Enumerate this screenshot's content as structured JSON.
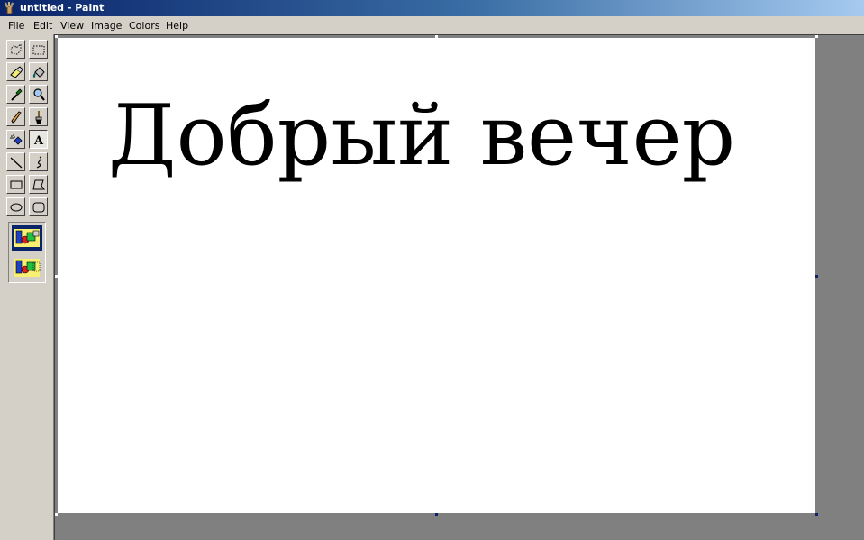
{
  "window": {
    "title": "untitled - Paint"
  },
  "menu": {
    "items": [
      "File",
      "Edit",
      "View",
      "Image",
      "Colors",
      "Help"
    ]
  },
  "toolbox": {
    "tools": [
      "free-form-select-icon",
      "select-icon",
      "eraser-icon",
      "fill-bucket-icon",
      "pick-color-icon",
      "magnifier-icon",
      "pencil-icon",
      "brush-icon",
      "airbrush-icon",
      "text-icon",
      "line-icon",
      "curve-icon",
      "rectangle-icon",
      "polygon-icon",
      "ellipse-icon",
      "rounded-rectangle-icon"
    ],
    "active_tool": "text-icon",
    "text_tool_glyph": "A",
    "options": [
      "opaque-background-icon",
      "transparent-background-icon"
    ],
    "active_option": "opaque-background-icon"
  },
  "canvas": {
    "text": "Добрый вечер",
    "background_color": "#ffffff",
    "text_color": "#000000"
  },
  "colors": {
    "titlebar_start": "#0a246a",
    "titlebar_end": "#a6caf0",
    "workspace": "#808080",
    "chrome": "#d4d0c8"
  }
}
